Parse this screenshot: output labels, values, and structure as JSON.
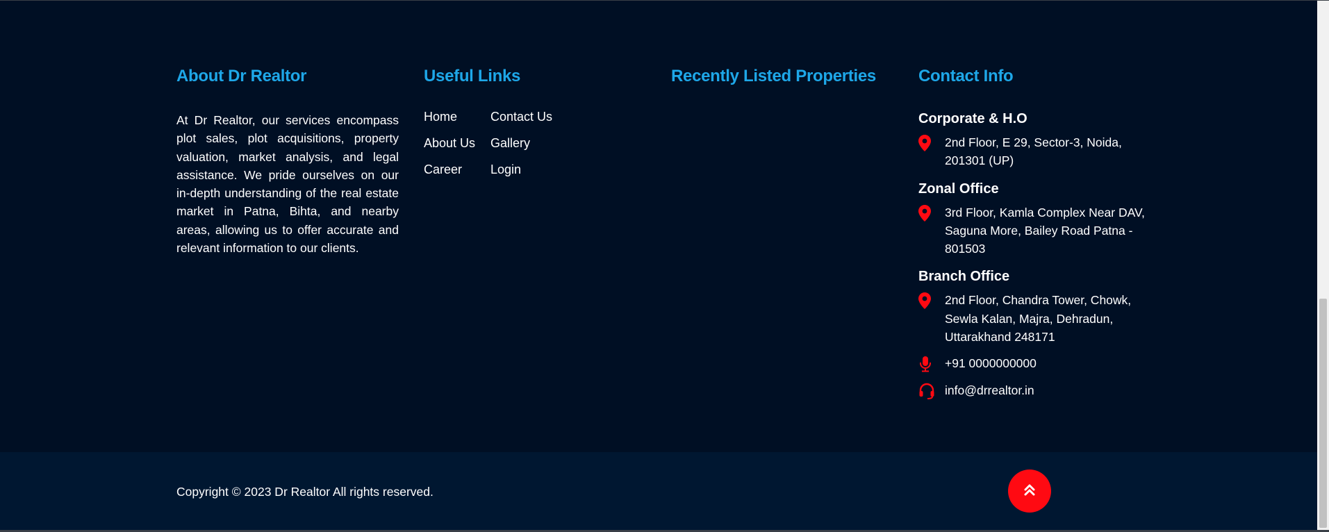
{
  "about": {
    "heading": "About Dr Realtor",
    "text": "At Dr Realtor, our services encompass plot sales, plot acquisitions, property valuation, market analysis, and legal assistance. We pride ourselves on our in-depth understanding of the real estate market in Patna, Bihta, and nearby areas, allowing us to offer accurate and relevant information to our clients."
  },
  "links": {
    "heading": "Useful Links",
    "items": [
      "Home",
      "Contact Us",
      "About Us",
      "Gallery",
      "Career",
      "Login"
    ]
  },
  "recent": {
    "heading": "Recently Listed Properties"
  },
  "contact": {
    "heading": "Contact Info",
    "corporate_title": "Corporate & H.O",
    "corporate_address": "2nd Floor, E 29, Sector-3, Noida, 201301 (UP)",
    "zonal_title": "Zonal Office",
    "zonal_address": "3rd Floor, Kamla Complex Near DAV, Saguna More, Bailey Road Patna - 801503",
    "branch_title": "Branch Office",
    "branch_address": "2nd Floor, Chandra Tower, Chowk, Sewla Kalan, Majra, Dehradun, Uttarakhand 248171",
    "phone": "+91 0000000000",
    "email": "info@drrealtor.in"
  },
  "bottom": {
    "copyright": "Copyright © 2023 Dr Realtor All rights reserved."
  },
  "colors": {
    "background": "#000f24",
    "bottom_bar": "#001731",
    "heading": "#1ea7e8",
    "icon_red": "#ff0a12"
  },
  "icons": {
    "address": "map-pin-icon",
    "phone": "microphone-icon",
    "email": "headset-icon",
    "to_top": "double-chevron-up-icon"
  }
}
